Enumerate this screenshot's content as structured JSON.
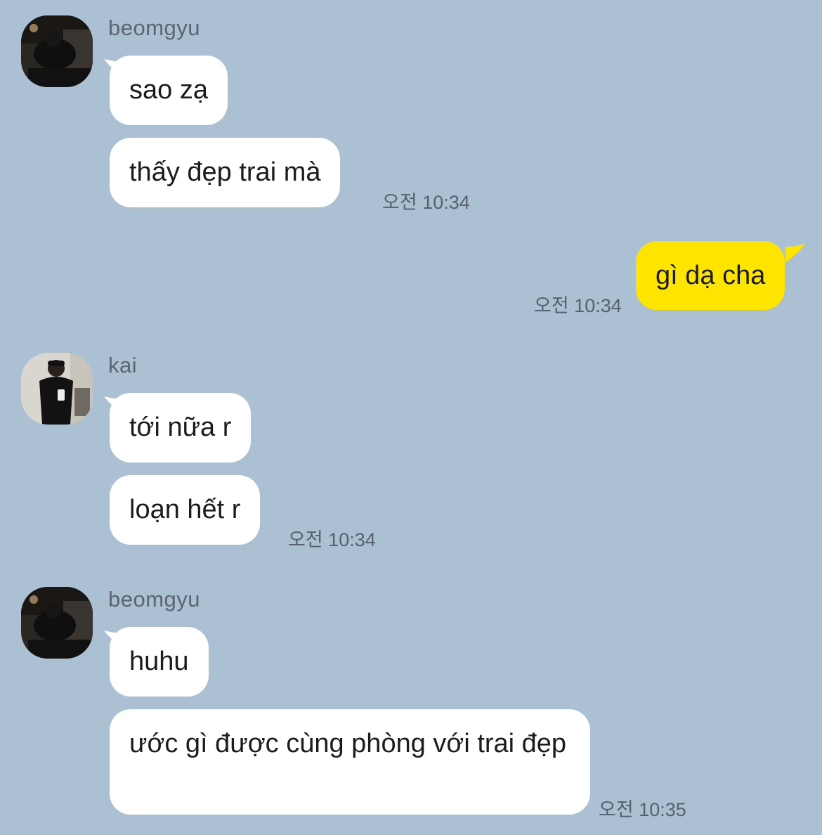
{
  "messages": [
    {
      "sender": "beomgyu",
      "bubbles": [
        "sao zạ",
        "thấy đẹp trai mà"
      ],
      "time": "오전 10:34"
    },
    {
      "sender": "me",
      "bubbles": [
        "gì dạ cha"
      ],
      "time": "오전 10:34"
    },
    {
      "sender": "kai",
      "bubbles": [
        "tới nữa r",
        "loạn hết r"
      ],
      "time": "오전 10:34"
    },
    {
      "sender": "beomgyu",
      "bubbles": [
        "huhu",
        "ước gì được cùng phòng với trai đẹp"
      ],
      "time": "오전 10:35"
    }
  ],
  "avatars": {
    "beomgyu": "dark-room-portrait",
    "kai": "mirror-selfie-portrait"
  },
  "colors": {
    "background": "#abc1d3",
    "incoming_bubble": "#ffffff",
    "outgoing_bubble": "#fee500"
  }
}
